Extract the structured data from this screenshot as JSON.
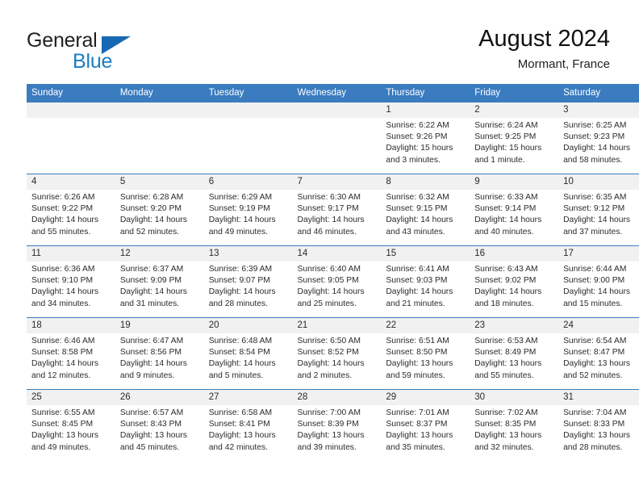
{
  "brand": {
    "name_part1": "General",
    "name_part2": "Blue"
  },
  "header": {
    "title": "August 2024",
    "subtitle": "Mormant, France"
  },
  "labels": {
    "sunrise_prefix": "Sunrise:",
    "sunset_prefix": "Sunset:",
    "daylight_prefix": "Daylight:"
  },
  "colors": {
    "header_blue": "#3b7cc0",
    "brand_blue": "#1a7dc4",
    "daynum_band": "#f1f1f1",
    "text": "#2b2b2b"
  },
  "weekdays": [
    "Sunday",
    "Monday",
    "Tuesday",
    "Wednesday",
    "Thursday",
    "Friday",
    "Saturday"
  ],
  "weeks": [
    [
      {
        "day": "",
        "sunrise": "",
        "sunset": "",
        "daylight_line1": "",
        "daylight_line2": ""
      },
      {
        "day": "",
        "sunrise": "",
        "sunset": "",
        "daylight_line1": "",
        "daylight_line2": ""
      },
      {
        "day": "",
        "sunrise": "",
        "sunset": "",
        "daylight_line1": "",
        "daylight_line2": ""
      },
      {
        "day": "",
        "sunrise": "",
        "sunset": "",
        "daylight_line1": "",
        "daylight_line2": ""
      },
      {
        "day": "1",
        "sunrise": "Sunrise: 6:22 AM",
        "sunset": "Sunset: 9:26 PM",
        "daylight_line1": "Daylight: 15 hours",
        "daylight_line2": "and 3 minutes."
      },
      {
        "day": "2",
        "sunrise": "Sunrise: 6:24 AM",
        "sunset": "Sunset: 9:25 PM",
        "daylight_line1": "Daylight: 15 hours",
        "daylight_line2": "and 1 minute."
      },
      {
        "day": "3",
        "sunrise": "Sunrise: 6:25 AM",
        "sunset": "Sunset: 9:23 PM",
        "daylight_line1": "Daylight: 14 hours",
        "daylight_line2": "and 58 minutes."
      }
    ],
    [
      {
        "day": "4",
        "sunrise": "Sunrise: 6:26 AM",
        "sunset": "Sunset: 9:22 PM",
        "daylight_line1": "Daylight: 14 hours",
        "daylight_line2": "and 55 minutes."
      },
      {
        "day": "5",
        "sunrise": "Sunrise: 6:28 AM",
        "sunset": "Sunset: 9:20 PM",
        "daylight_line1": "Daylight: 14 hours",
        "daylight_line2": "and 52 minutes."
      },
      {
        "day": "6",
        "sunrise": "Sunrise: 6:29 AM",
        "sunset": "Sunset: 9:19 PM",
        "daylight_line1": "Daylight: 14 hours",
        "daylight_line2": "and 49 minutes."
      },
      {
        "day": "7",
        "sunrise": "Sunrise: 6:30 AM",
        "sunset": "Sunset: 9:17 PM",
        "daylight_line1": "Daylight: 14 hours",
        "daylight_line2": "and 46 minutes."
      },
      {
        "day": "8",
        "sunrise": "Sunrise: 6:32 AM",
        "sunset": "Sunset: 9:15 PM",
        "daylight_line1": "Daylight: 14 hours",
        "daylight_line2": "and 43 minutes."
      },
      {
        "day": "9",
        "sunrise": "Sunrise: 6:33 AM",
        "sunset": "Sunset: 9:14 PM",
        "daylight_line1": "Daylight: 14 hours",
        "daylight_line2": "and 40 minutes."
      },
      {
        "day": "10",
        "sunrise": "Sunrise: 6:35 AM",
        "sunset": "Sunset: 9:12 PM",
        "daylight_line1": "Daylight: 14 hours",
        "daylight_line2": "and 37 minutes."
      }
    ],
    [
      {
        "day": "11",
        "sunrise": "Sunrise: 6:36 AM",
        "sunset": "Sunset: 9:10 PM",
        "daylight_line1": "Daylight: 14 hours",
        "daylight_line2": "and 34 minutes."
      },
      {
        "day": "12",
        "sunrise": "Sunrise: 6:37 AM",
        "sunset": "Sunset: 9:09 PM",
        "daylight_line1": "Daylight: 14 hours",
        "daylight_line2": "and 31 minutes."
      },
      {
        "day": "13",
        "sunrise": "Sunrise: 6:39 AM",
        "sunset": "Sunset: 9:07 PM",
        "daylight_line1": "Daylight: 14 hours",
        "daylight_line2": "and 28 minutes."
      },
      {
        "day": "14",
        "sunrise": "Sunrise: 6:40 AM",
        "sunset": "Sunset: 9:05 PM",
        "daylight_line1": "Daylight: 14 hours",
        "daylight_line2": "and 25 minutes."
      },
      {
        "day": "15",
        "sunrise": "Sunrise: 6:41 AM",
        "sunset": "Sunset: 9:03 PM",
        "daylight_line1": "Daylight: 14 hours",
        "daylight_line2": "and 21 minutes."
      },
      {
        "day": "16",
        "sunrise": "Sunrise: 6:43 AM",
        "sunset": "Sunset: 9:02 PM",
        "daylight_line1": "Daylight: 14 hours",
        "daylight_line2": "and 18 minutes."
      },
      {
        "day": "17",
        "sunrise": "Sunrise: 6:44 AM",
        "sunset": "Sunset: 9:00 PM",
        "daylight_line1": "Daylight: 14 hours",
        "daylight_line2": "and 15 minutes."
      }
    ],
    [
      {
        "day": "18",
        "sunrise": "Sunrise: 6:46 AM",
        "sunset": "Sunset: 8:58 PM",
        "daylight_line1": "Daylight: 14 hours",
        "daylight_line2": "and 12 minutes."
      },
      {
        "day": "19",
        "sunrise": "Sunrise: 6:47 AM",
        "sunset": "Sunset: 8:56 PM",
        "daylight_line1": "Daylight: 14 hours",
        "daylight_line2": "and 9 minutes."
      },
      {
        "day": "20",
        "sunrise": "Sunrise: 6:48 AM",
        "sunset": "Sunset: 8:54 PM",
        "daylight_line1": "Daylight: 14 hours",
        "daylight_line2": "and 5 minutes."
      },
      {
        "day": "21",
        "sunrise": "Sunrise: 6:50 AM",
        "sunset": "Sunset: 8:52 PM",
        "daylight_line1": "Daylight: 14 hours",
        "daylight_line2": "and 2 minutes."
      },
      {
        "day": "22",
        "sunrise": "Sunrise: 6:51 AM",
        "sunset": "Sunset: 8:50 PM",
        "daylight_line1": "Daylight: 13 hours",
        "daylight_line2": "and 59 minutes."
      },
      {
        "day": "23",
        "sunrise": "Sunrise: 6:53 AM",
        "sunset": "Sunset: 8:49 PM",
        "daylight_line1": "Daylight: 13 hours",
        "daylight_line2": "and 55 minutes."
      },
      {
        "day": "24",
        "sunrise": "Sunrise: 6:54 AM",
        "sunset": "Sunset: 8:47 PM",
        "daylight_line1": "Daylight: 13 hours",
        "daylight_line2": "and 52 minutes."
      }
    ],
    [
      {
        "day": "25",
        "sunrise": "Sunrise: 6:55 AM",
        "sunset": "Sunset: 8:45 PM",
        "daylight_line1": "Daylight: 13 hours",
        "daylight_line2": "and 49 minutes."
      },
      {
        "day": "26",
        "sunrise": "Sunrise: 6:57 AM",
        "sunset": "Sunset: 8:43 PM",
        "daylight_line1": "Daylight: 13 hours",
        "daylight_line2": "and 45 minutes."
      },
      {
        "day": "27",
        "sunrise": "Sunrise: 6:58 AM",
        "sunset": "Sunset: 8:41 PM",
        "daylight_line1": "Daylight: 13 hours",
        "daylight_line2": "and 42 minutes."
      },
      {
        "day": "28",
        "sunrise": "Sunrise: 7:00 AM",
        "sunset": "Sunset: 8:39 PM",
        "daylight_line1": "Daylight: 13 hours",
        "daylight_line2": "and 39 minutes."
      },
      {
        "day": "29",
        "sunrise": "Sunrise: 7:01 AM",
        "sunset": "Sunset: 8:37 PM",
        "daylight_line1": "Daylight: 13 hours",
        "daylight_line2": "and 35 minutes."
      },
      {
        "day": "30",
        "sunrise": "Sunrise: 7:02 AM",
        "sunset": "Sunset: 8:35 PM",
        "daylight_line1": "Daylight: 13 hours",
        "daylight_line2": "and 32 minutes."
      },
      {
        "day": "31",
        "sunrise": "Sunrise: 7:04 AM",
        "sunset": "Sunset: 8:33 PM",
        "daylight_line1": "Daylight: 13 hours",
        "daylight_line2": "and 28 minutes."
      }
    ]
  ]
}
